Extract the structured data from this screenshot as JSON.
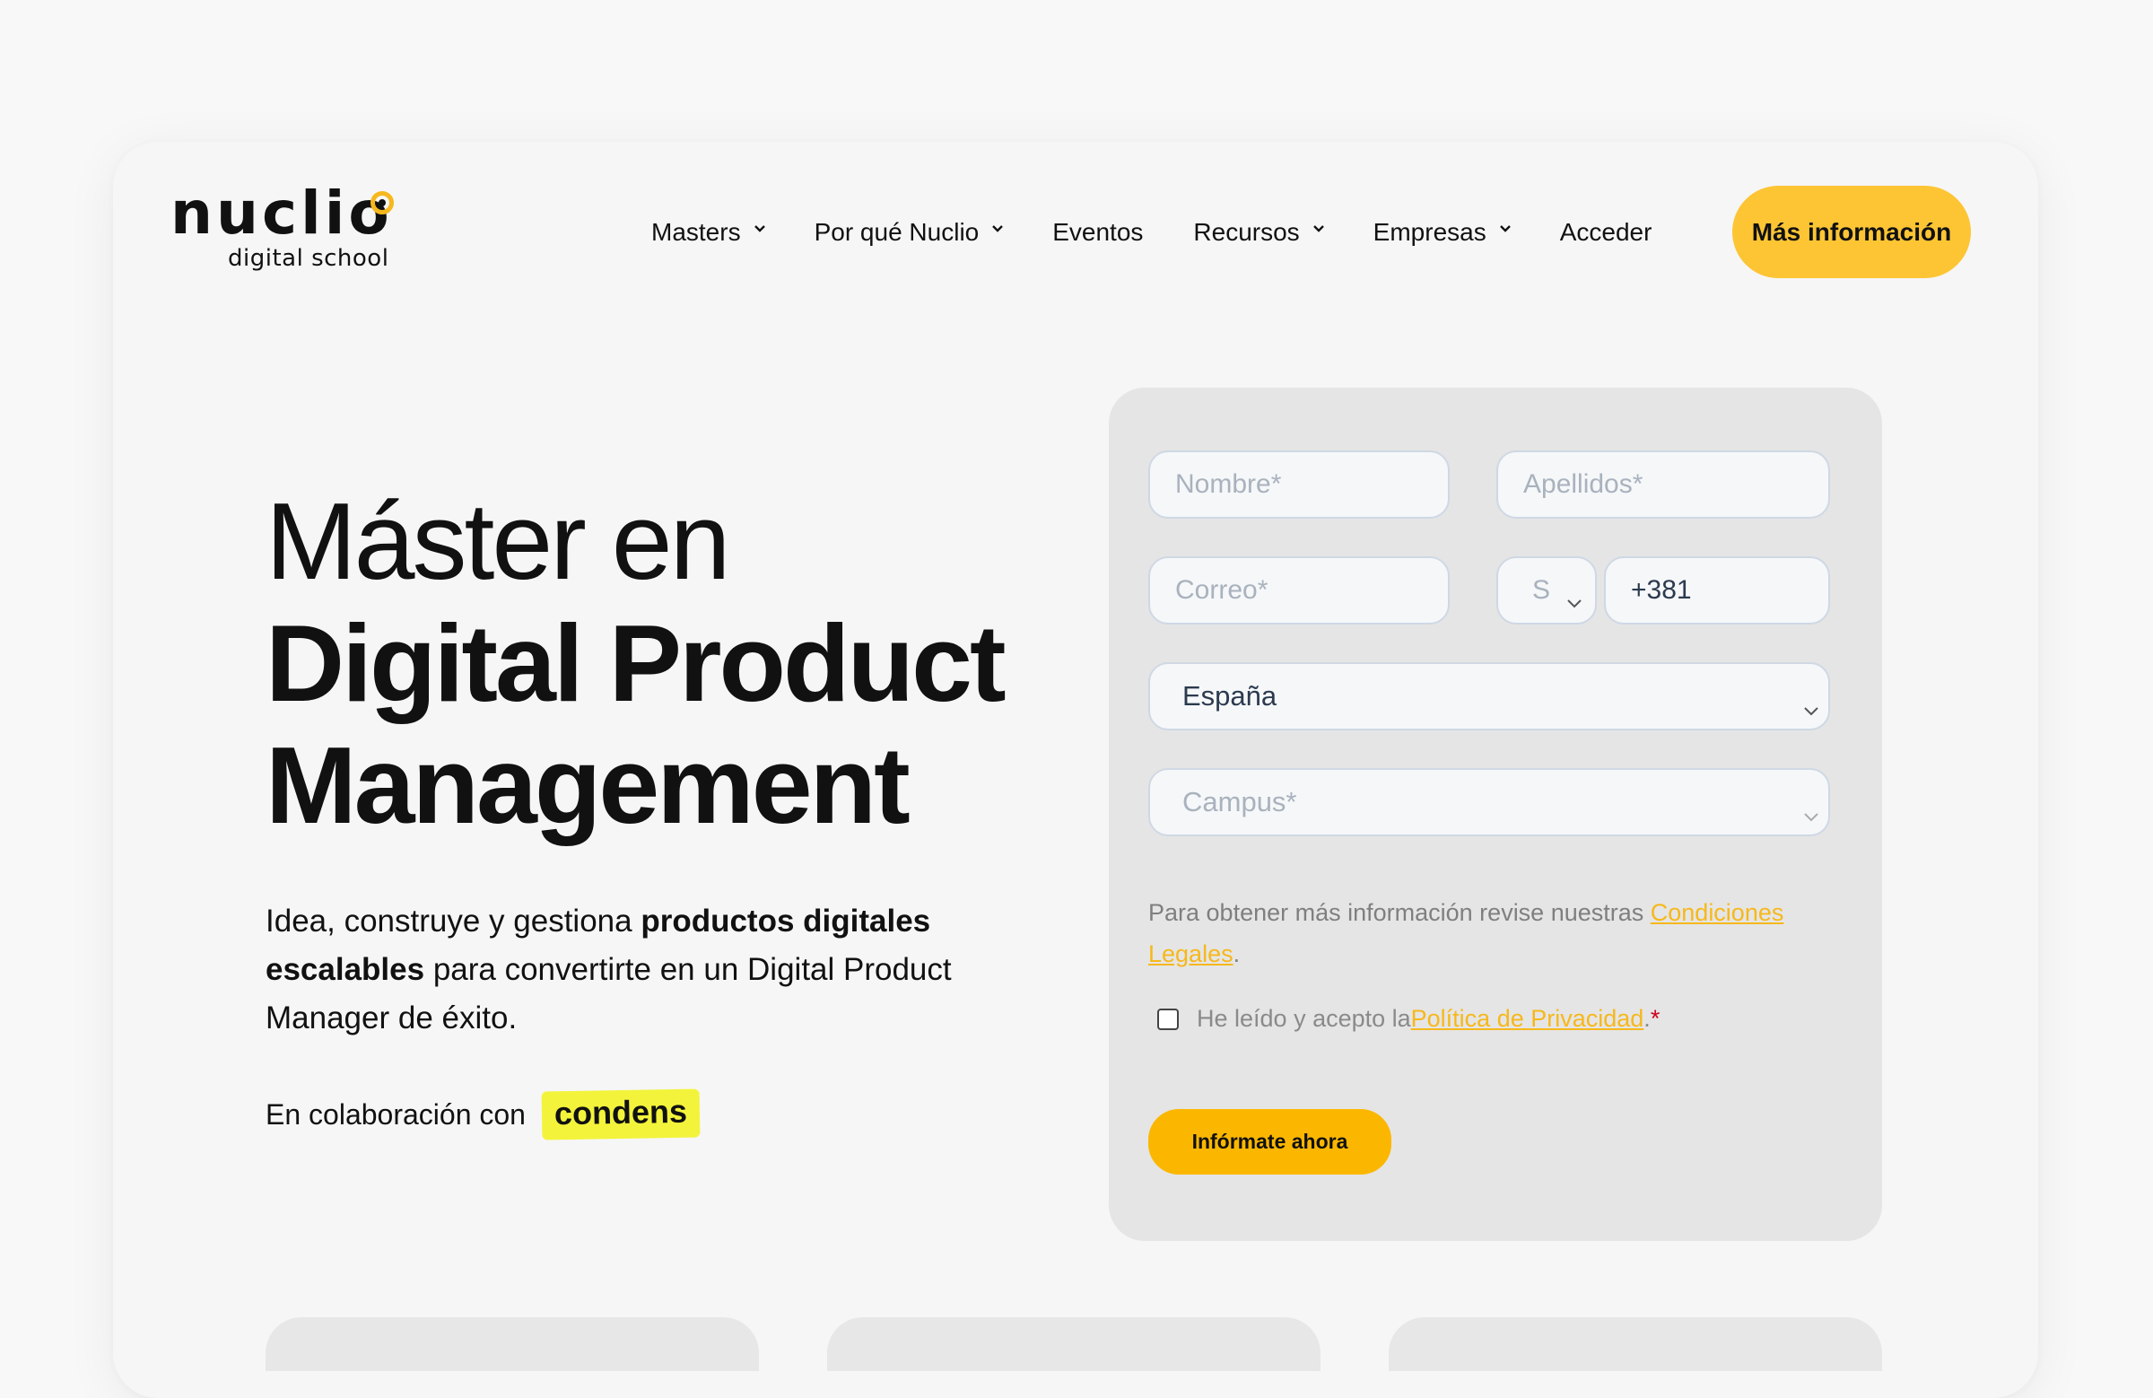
{
  "brand": {
    "logo_word": "nuclio",
    "logo_sub": "digital school",
    "accent": "#fdc534"
  },
  "nav": {
    "items": [
      {
        "label": "Masters",
        "has_dropdown": true
      },
      {
        "label": "Por qué Nuclio",
        "has_dropdown": true
      },
      {
        "label": "Eventos",
        "has_dropdown": false
      },
      {
        "label": "Recursos",
        "has_dropdown": true
      },
      {
        "label": "Empresas",
        "has_dropdown": true
      },
      {
        "label": "Acceder",
        "has_dropdown": false
      }
    ],
    "cta_label": "Más información"
  },
  "hero": {
    "title_line1": "Máster en",
    "title_line2": "Digital Product",
    "title_line3": "Management",
    "desc_part1": "Idea, construye y gestiona ",
    "desc_bold1": "productos digitales",
    "desc_bold2": "escalables",
    "desc_part2": " para convertirte en un Digital Product Manager de éxito.",
    "collab_label": "En colaboración con",
    "collab_brand": "condens"
  },
  "form": {
    "nombre_placeholder": "Nombre*",
    "apellidos_placeholder": "Apellidos*",
    "correo_placeholder": "Correo*",
    "prefix_value": "S",
    "phone_value": "+381",
    "country_value": "España",
    "campus_placeholder": "Campus*",
    "legal_text": "Para obtener más información revise nuestras ",
    "legal_link": "Condiciones Legales",
    "legal_end": ".",
    "consent_text": "He leído y acepto la ",
    "consent_link": "Política de Privacidad",
    "consent_end": ".",
    "required_mark": "*",
    "submit_label": "Infórmate ahora"
  }
}
